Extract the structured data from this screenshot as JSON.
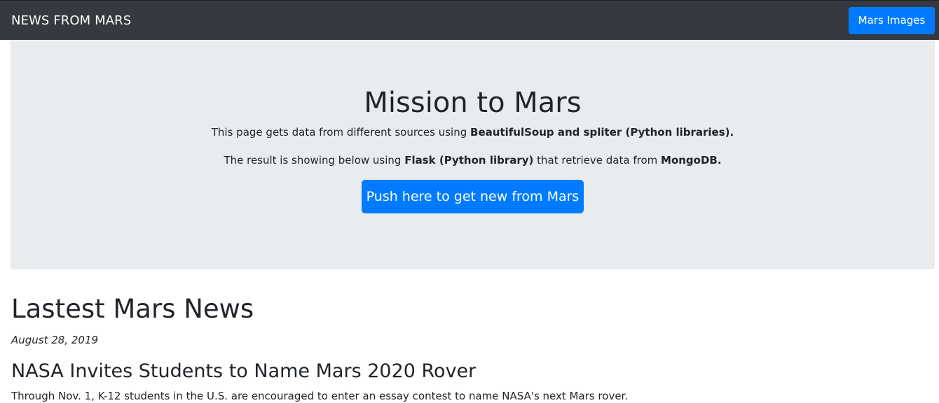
{
  "navbar": {
    "brand": "NEWS FROM MARS",
    "images_button": "Mars Images"
  },
  "jumbotron": {
    "title": "Mission to Mars",
    "line1": {
      "prefix": "This page gets data from different sources using ",
      "bold": "BeautifulSoup and spliter (Python libraries)."
    },
    "line2": {
      "prefix": "The result is showing below using ",
      "bold1": "Flask (Python library)",
      "middle": " that retrieve data from ",
      "bold2": "MongoDB."
    },
    "scrape_button": "Push here to get new from Mars"
  },
  "news": {
    "heading": "Lastest Mars News",
    "date": "August 28, 2019",
    "title": "NASA Invites Students to Name Mars 2020 Rover",
    "body": "Through Nov. 1, K-12 students in the U.S. are encouraged to enter an essay contest to name NASA's next Mars rover."
  },
  "colors": {
    "navbar_bg": "#343a40",
    "primary": "#007bff",
    "jumbotron_bg": "#e9ecef",
    "text": "#212529"
  }
}
